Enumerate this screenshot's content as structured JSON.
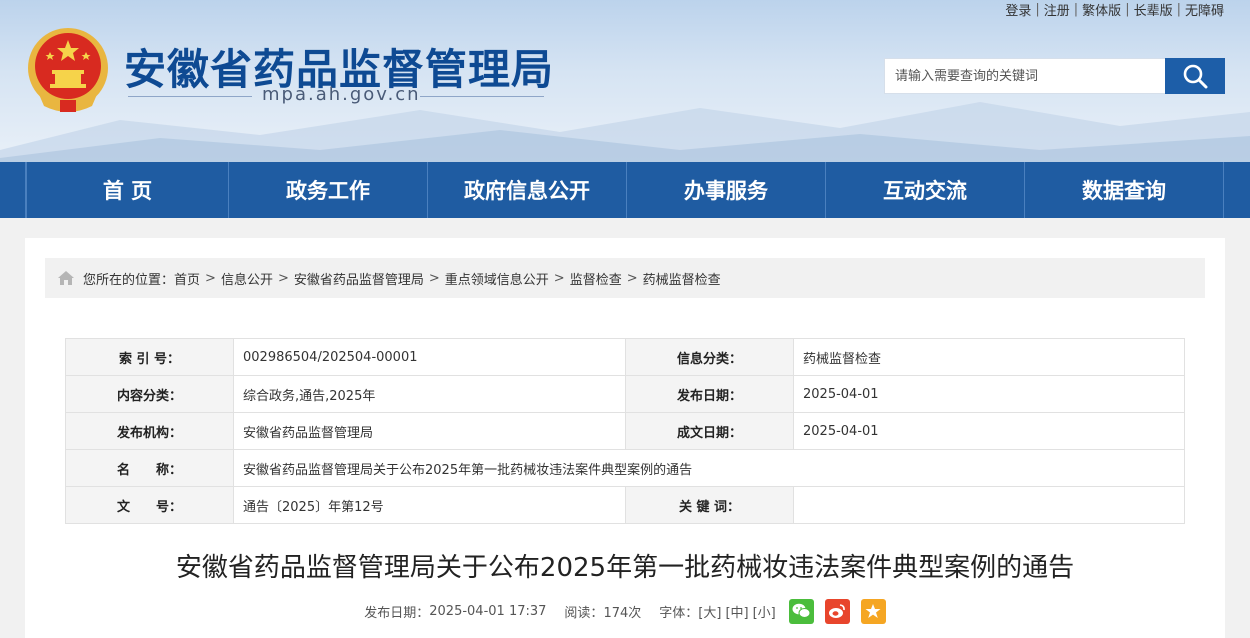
{
  "header": {
    "top_links": [
      "登录",
      "注册",
      "繁体版",
      "长辈版",
      "无障碍"
    ],
    "site_title": "安徽省药品监督管理局",
    "site_domain": "mpa.ah.gov.cn",
    "search_placeholder": "请输入需要查询的关键词"
  },
  "nav": {
    "items": [
      "首 页",
      "政务工作",
      "政府信息公开",
      "办事服务",
      "互动交流",
      "数据查询"
    ]
  },
  "breadcrumb": {
    "prefix": "您所在的位置：",
    "items": [
      "首页",
      "信息公开",
      "安徽省药品监督管理局",
      "重点领域信息公开",
      "监督检查",
      "药械监督检查"
    ],
    "separator": ">"
  },
  "meta_table": {
    "index_label": "索 引 号：",
    "index_value": "002986504/202504-00001",
    "category_label": "信息分类：",
    "category_value": "药械监督检查",
    "content_type_label": "内容分类：",
    "content_type_value": "综合政务,通告,2025年",
    "publish_date_label": "发布日期：",
    "publish_date_value": "2025-04-01",
    "org_label": "发布机构：",
    "org_value": "安徽省药品监督管理局",
    "created_date_label": "成文日期：",
    "created_date_value": "2025-04-01",
    "name_label": "名　　称：",
    "name_value": "安徽省药品监督管理局关于公布2025年第一批药械妆违法案件典型案例的通告",
    "doc_no_label": "文　　号：",
    "doc_no_value": "通告〔2025〕年第12号",
    "keywords_label": "关 键 词：",
    "keywords_value": ""
  },
  "article": {
    "title": "安徽省药品监督管理局关于公布2025年第一批药械妆违法案件典型案例的通告",
    "publish_label": "发布日期：",
    "publish_value": "2025-04-01 17:37",
    "views_label": "阅读：",
    "views_value": "174次",
    "fontsize_label": "字体：",
    "font_large": "[大]",
    "font_medium": "[中]",
    "font_small": "[小]"
  },
  "colors": {
    "nav_bg": "#1f5ca2",
    "title_blue": "#0e4a93",
    "wechat": "#4bbd3c",
    "weibo": "#e8452c",
    "favorite": "#f5a623"
  }
}
